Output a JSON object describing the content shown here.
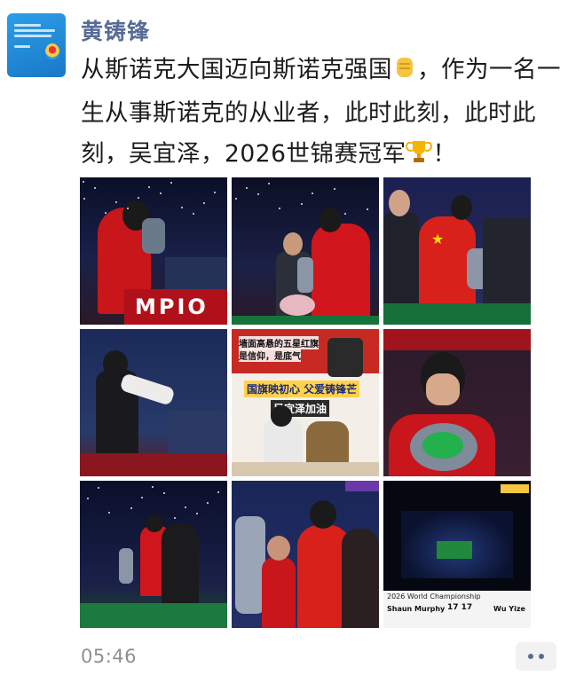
{
  "post": {
    "author": "黄铸锋",
    "text_part1": "从斯诺克大国迈向斯诺克强国",
    "text_part2": "，作为一名一生从事斯诺克的从业者，此时此刻，此时此刻，吴宜泽，2026世锦赛冠军",
    "text_part3": "！",
    "emoji1": "fist-emoji",
    "emoji2": "trophy-emoji",
    "time": "05:46"
  },
  "photos": [
    {
      "id": "photo-1",
      "overlay": "MPIO"
    },
    {
      "id": "photo-2"
    },
    {
      "id": "photo-3"
    },
    {
      "id": "photo-4"
    },
    {
      "id": "photo-5",
      "caption_top1": "墙面高悬的五星红旗",
      "caption_top2": "是信仰，是底气",
      "caption_mid": "国旗映初心 父爱铸锋芒",
      "caption_name": "吴宜泽加油"
    },
    {
      "id": "photo-6"
    },
    {
      "id": "photo-7"
    },
    {
      "id": "photo-8"
    },
    {
      "id": "photo-9",
      "event": "2026 World Championship",
      "player1": "Shaun Murphy",
      "score": "17 17",
      "player2": "Wu Yize"
    }
  ],
  "colors": {
    "author": "#576b95",
    "text": "#1c1c1c",
    "time": "#8f8f8f",
    "flag_red": "#d8211b",
    "flag_yellow": "#ffde00"
  }
}
